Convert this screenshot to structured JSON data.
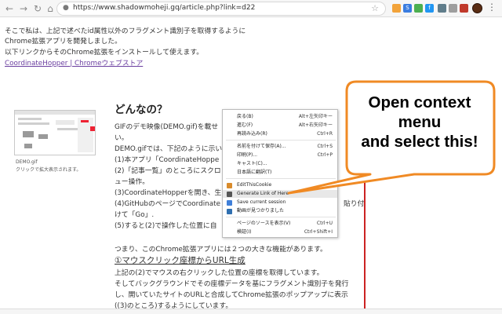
{
  "browser": {
    "back_icon": "←",
    "forward_icon": "→",
    "reload_icon": "↻",
    "home_icon": "⌂",
    "lock_icon": "🔒",
    "url": "https://www.shadowmoheji.gq/article.php?link=d22",
    "star_icon": "☆",
    "menu_icon": "⋮",
    "extensions": [
      {
        "name": "ext-icon-1",
        "color": "#f2a33a",
        "glyph": ""
      },
      {
        "name": "ext-icon-2",
        "color": "#3b7de0",
        "glyph": "S"
      },
      {
        "name": "ext-icon-3",
        "color": "#4caf50",
        "glyph": ""
      },
      {
        "name": "ext-icon-4",
        "color": "#2196f3",
        "glyph": "f"
      },
      {
        "name": "ext-icon-5",
        "color": "#607d8b",
        "glyph": ""
      },
      {
        "name": "ext-icon-6",
        "color": "#9e9e9e",
        "glyph": ""
      },
      {
        "name": "ext-icon-7",
        "color": "#c0392b",
        "glyph": ""
      }
    ]
  },
  "intro": {
    "line1": "そこで私は、上記で述べたid属性以外のフラグメント識別子を取得するように",
    "line2": "Chrome拡張アプリを開発しました。",
    "line3": "以下リンクからそのChrome拡張をインストールして使えます。",
    "link": "CoordinateHopper | Chromeウェブストア"
  },
  "section": {
    "heading": "どんなの？",
    "thumb_caption": "DEMO.gif",
    "thumb_caption2": "クリックで拡大表示されます。",
    "lines": [
      "GIFのデモ映像(DEMO.gif)を載せ",
      "い。",
      "DEMO.gifでは、下記のように示い",
      "(1)本アプリ「CoordinateHoppe",
      "(2)「記事一覧」のところにスクロ",
      "ュー操作。",
      "(3)CoordinateHopperを開き、生",
      "(4)GitHubのページでCoordinate",
      "けて「Go」.",
      "(5)すると(2)で操作した位置に自"
    ],
    "line4_tail": "貼り付",
    "para2": "つまり、このChrome拡張アプリには２つの大きな機能があります。",
    "feature1": "①マウスクリック座標からURL生成",
    "para3": "上記の(2)でマウスの右クリックした位置の座標を取得しています。",
    "para4": "そしてバックグラウンドでその座標データを基にフラグメント識別子を発行",
    "para5": "し、開いていたサイトのURLと合成してChrome拡張のポップアップに表示",
    "para6": "((3)のところ)するようにしています。"
  },
  "context_menu": {
    "items": [
      {
        "label": "戻る(B)",
        "shortcut": "Alt+左矢印キー"
      },
      {
        "label": "進む(F)",
        "shortcut": "Alt+右矢印キー"
      },
      {
        "label": "再読み込み(R)",
        "shortcut": "Ctrl+R"
      },
      {
        "label": "名前を付けて保存(A)...",
        "shortcut": "Ctrl+S"
      },
      {
        "label": "印刷(P)...",
        "shortcut": "Ctrl+P"
      },
      {
        "label": "キャスト(C)...",
        "shortcut": ""
      },
      {
        "label": "日本語に翻訳(T)",
        "shortcut": ""
      },
      {
        "label": "EditThisCookie",
        "shortcut": "",
        "icon": "cookie-icon",
        "icon_color": "#d98b2b"
      },
      {
        "label": "Generate Link of Here",
        "shortcut": "",
        "icon": "coordinatehopper-icon",
        "icon_color": "#555555"
      },
      {
        "label": "Save current session",
        "shortcut": "",
        "icon": "session-icon",
        "icon_color": "#3f7fd9"
      },
      {
        "label": "動画が見つかりました",
        "shortcut": "",
        "icon": "video-icon",
        "icon_color": "#2f6fb0"
      },
      {
        "label": "ページのソースを表示(V)",
        "shortcut": "Ctrl+U"
      },
      {
        "label": "検証(I)",
        "shortcut": "Ctrl+Shift+I"
      }
    ]
  },
  "callout": {
    "line1": "Open context",
    "line2": "menu",
    "line3": "and select this!",
    "border_color": "#f08a24"
  }
}
